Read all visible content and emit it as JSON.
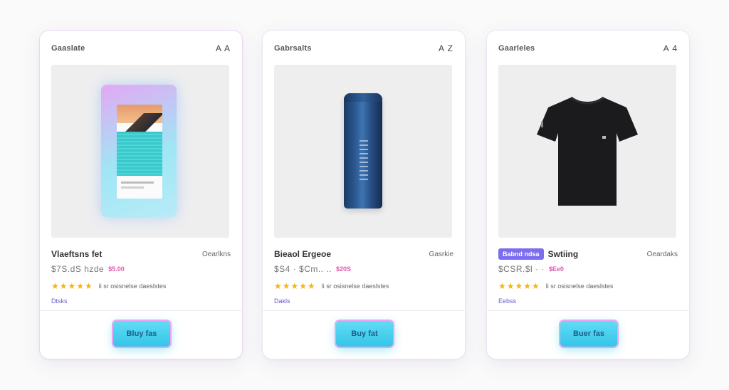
{
  "products": [
    {
      "category": "Gaaslate",
      "counter": "A A",
      "name": "Vlaeftsns fet",
      "side_label": "Oearlkns",
      "badge": "",
      "price": "$7S.dS hzde",
      "discount": "$5.00",
      "stars": "★★★★★",
      "reviews": "li sr osisnelse daeslstes",
      "stock": "Dtsks",
      "button": "Bluy fas",
      "image_icon": "phone-screen"
    },
    {
      "category": "Gabrsalts",
      "counter": "A Z",
      "name": "Bieaol Ergeoe",
      "side_label": "Gasrkie",
      "badge": "",
      "price": "$S4 · $Cm.. ..",
      "discount": "$20S",
      "stars": "★★★★★",
      "reviews": "li sr osisnelse daeslstes",
      "stock": "Dakls",
      "button": "Buy fat",
      "image_icon": "spray-bottle"
    },
    {
      "category": "Gaarleles",
      "counter": "A 4",
      "name": "Swtiing",
      "side_label": "Oeardaks",
      "badge": "Babnd ndsa",
      "price": "$CSR.$l · ·",
      "discount": "$Ee0",
      "stars": "★★★★★",
      "reviews": "li sr osisnelse daeslstes",
      "stock": "Eebss",
      "button": "Buer fas",
      "image_icon": "t-shirt"
    }
  ]
}
